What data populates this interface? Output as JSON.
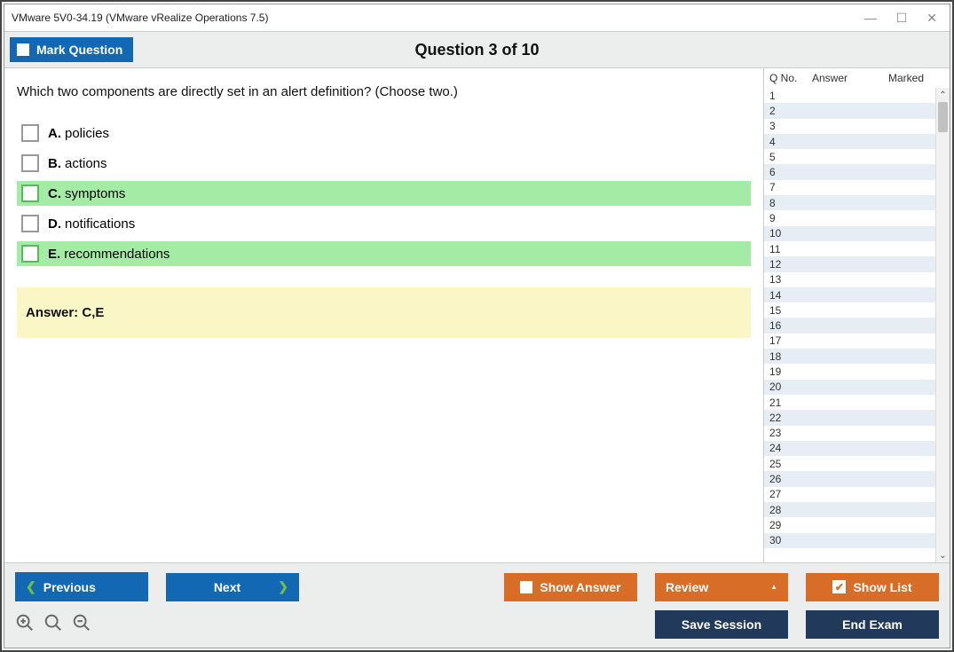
{
  "window": {
    "title": "VMware 5V0-34.19 (VMware vRealize Operations 7.5)"
  },
  "topbar": {
    "mark_label": "Mark Question",
    "question_title": "Question 3 of 10"
  },
  "question": {
    "text": "Which two components are directly set in an alert definition? (Choose two.)",
    "options": [
      {
        "letter": "A.",
        "text": "policies",
        "highlight": false
      },
      {
        "letter": "B.",
        "text": "actions",
        "highlight": false
      },
      {
        "letter": "C.",
        "text": "symptoms",
        "highlight": true
      },
      {
        "letter": "D.",
        "text": "notifications",
        "highlight": false
      },
      {
        "letter": "E.",
        "text": "recommendations",
        "highlight": true
      }
    ],
    "answer_label": "Answer:",
    "answer_value": "C,E"
  },
  "side": {
    "headers": {
      "qno": "Q No.",
      "answer": "Answer",
      "marked": "Marked"
    },
    "row_count": 30
  },
  "buttons": {
    "previous": "Previous",
    "next": "Next",
    "show_answer": "Show Answer",
    "review": "Review",
    "show_list": "Show List",
    "save_session": "Save Session",
    "end_exam": "End Exam"
  }
}
